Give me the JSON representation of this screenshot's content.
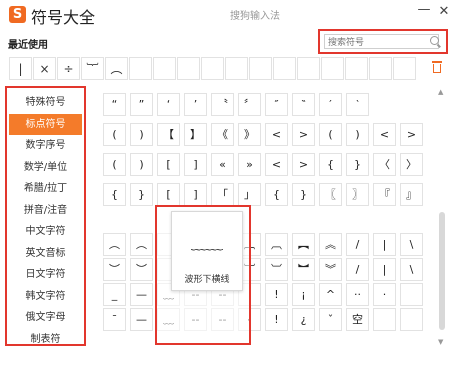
{
  "window": {
    "logo_char": "S",
    "app_title": "符号大全",
    "center_title": "搜狗输入法",
    "minimize_label": "—",
    "close_label": "✕"
  },
  "recent": {
    "label": "最近使用",
    "symbols": [
      "|",
      "×",
      "÷",
      "︸",
      "︵",
      "",
      "",
      "",
      "",
      "",
      "",
      "",
      "",
      "",
      "",
      "",
      ""
    ]
  },
  "search": {
    "placeholder": "搜索符号"
  },
  "sidebar": {
    "items": [
      {
        "label": "特殊符号"
      },
      {
        "label": "标点符号",
        "active": true
      },
      {
        "label": "数字序号"
      },
      {
        "label": "数学/单位"
      },
      {
        "label": "希腊/拉丁"
      },
      {
        "label": "拼音/注音"
      },
      {
        "label": "中文字符"
      },
      {
        "label": "英文音标"
      },
      {
        "label": "日文字符"
      },
      {
        "label": "韩文字符"
      },
      {
        "label": "俄文字母"
      },
      {
        "label": "制表符"
      }
    ]
  },
  "symbol_grid": {
    "rows": [
      [
        "“",
        "”",
        "‘",
        "’",
        "〝",
        "〞",
        "″",
        "‶",
        "′",
        "‵"
      ],
      [
        "(",
        ")",
        "【",
        "】",
        "《",
        "》",
        "<",
        ">",
        "(",
        ")",
        "<",
        ">"
      ],
      [
        "(",
        ")",
        "[",
        "]",
        "«",
        "»",
        "<",
        ">",
        "{",
        "}",
        "〈",
        "〉"
      ],
      [
        "{",
        "}",
        "[",
        "]",
        "「",
        "」",
        "{",
        "}",
        "〖",
        "〗",
        "『",
        "』"
      ],
      [],
      [
        "︵",
        "︵",
        "",
        "",
        "",
        "︷",
        "︹",
        "︻",
        "︽",
        "/",
        "|",
        "\\"
      ],
      [
        "︶",
        "︶",
        "",
        "",
        "",
        "︸",
        "︺",
        "︼",
        "︾",
        "/",
        "|",
        "\\"
      ],
      [
        "_",
        "—",
        "﹏",
        "--",
        "--",
        "",
        "!",
        "¡",
        "^",
        "··",
        "·",
        ""
      ],
      [
        "¯",
        "—",
        "﹏",
        "--",
        "--",
        "‹",
        "!",
        "¿",
        "ˇ",
        "空",
        "",
        ""
      ]
    ]
  },
  "popup": {
    "symbol": "﹏﹏",
    "name": "波形下横线"
  }
}
